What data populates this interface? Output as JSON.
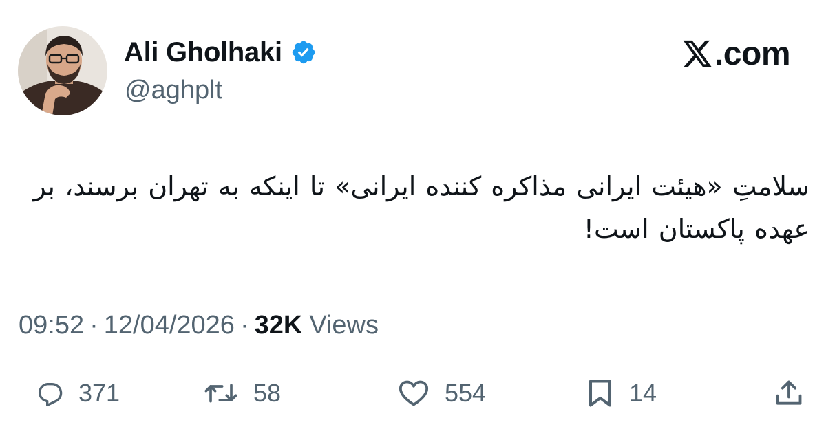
{
  "author": {
    "display_name": "Ali Gholhaki",
    "handle": "@aghplt",
    "verified": true,
    "avatar_icon": "profile-photo"
  },
  "brand": {
    "text": ".com",
    "icon": "x-logo"
  },
  "tweet": {
    "text": "سلامتِ «هیئت ایرانی مذاکره کننده ایرانی» تا اینکه به تهران برسند، بر عهده پاکستان است!"
  },
  "meta": {
    "time": "09:52",
    "separator": "·",
    "date": "12/04/2026",
    "views_count": "32K",
    "views_label": "Views"
  },
  "actions": {
    "replies": {
      "count": "371",
      "icon": "reply-icon"
    },
    "retweets": {
      "count": "58",
      "icon": "retweet-icon"
    },
    "likes": {
      "count": "554",
      "icon": "heart-icon"
    },
    "bookmarks": {
      "count": "14",
      "icon": "bookmark-icon"
    },
    "share": {
      "icon": "share-icon"
    }
  },
  "colors": {
    "text": "#0f1419",
    "secondary": "#536471",
    "verified": "#1d9bf0",
    "background": "#ffffff"
  }
}
